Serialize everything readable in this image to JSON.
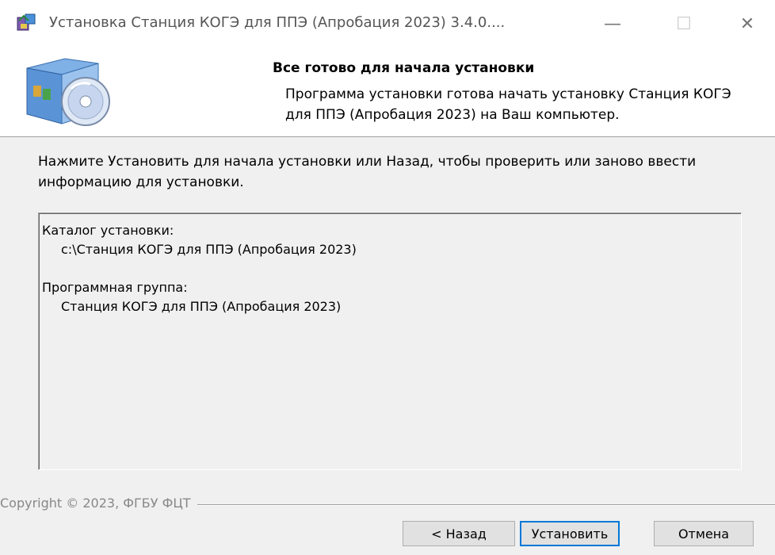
{
  "window": {
    "title": "Установка Станция КОГЭ для ППЭ (Апробация 2023) 3.4.0....",
    "minimize_glyph": "—",
    "maximize_glyph": "☐",
    "close_glyph": "✕"
  },
  "header": {
    "title": "Все готово для начала установки",
    "subtitle": "Программа установки готова начать установку Станция КОГЭ для ППЭ (Апробация 2023) на Ваш компьютер.",
    "icon": "installer-cd-box-icon"
  },
  "instruction": "Нажмите Установить для начала установки или Назад, чтобы проверить или заново ввести информацию для установки.",
  "summary": {
    "install_dir_label": "Каталог установки:",
    "install_dir_value": "c:\\Станция КОГЭ для ППЭ (Апробация 2023)",
    "program_group_label": "Программная группа:",
    "program_group_value": "Станция КОГЭ для ППЭ (Апробация 2023)"
  },
  "footer": {
    "copyright": "Copyright © 2023, ФГБУ ФЦТ"
  },
  "buttons": {
    "back": "< Назад",
    "install": "Установить",
    "cancel": "Отмена"
  },
  "colors": {
    "accent": "#0078d7",
    "dialog_bg": "#f0f0f0",
    "header_bg": "#ffffff"
  }
}
